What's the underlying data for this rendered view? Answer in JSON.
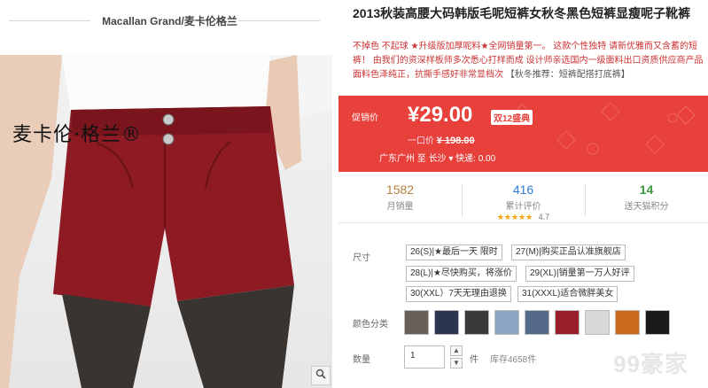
{
  "store": {
    "name": "Macallan Grand/麦卡伦格兰"
  },
  "brand_logo": "麦卡伦·格兰®",
  "product": {
    "title": "2013秋装高腰大码韩版毛呢短裤女秋冬黑色短裤显瘦呢子靴裤",
    "desc_red": "不掉色 不起球 ★升级版加厚呢料★全网销量第一。 这款个性独特 请新优雅而又含蓄的短裤！ 由我们的资深样板师多次悉心打样而成 设计师亲选国内一级面料出口资质供应商产品 面料色泽纯正，抗撕手感好非常显档次",
    "desc_tail": "【秋冬推荐：短裤配搭打底裤】"
  },
  "price": {
    "promo_label": "促销价",
    "current": "¥29.00",
    "badge": "双12盛典",
    "orig_label": "一口价",
    "orig_value": "¥ 198.00",
    "ship_from": "广东广州 至",
    "ship_to": "长沙",
    "ship_fee": "快递: 0.00",
    "accent": "#e8413c"
  },
  "stats": {
    "sold_value": "1582",
    "sold_label": "月销量",
    "review_value": "416",
    "review_label": "累计评价",
    "rating_stars": "★★★★★",
    "rating": "4.7",
    "points_value": "14",
    "points_label": "送天猫积分"
  },
  "options": {
    "size_label": "尺寸",
    "sizes": [
      "26(S)|★最后一天 限时",
      "27(M)|购买正品认准旗舰店",
      "28(L)|★尽快购买，将涨价",
      "29(XL)|销量第一万人好评",
      "30(XXL）7天无理由退换",
      "31(XXXL)适合微胖美女"
    ],
    "color_label": "颜色分类",
    "swatch_colors": [
      "#6a6058",
      "#2b3550",
      "#3a3a3c",
      "#8aa4c4",
      "#556a8a",
      "#9a1f2a",
      "#d8d8d8",
      "#c86a1a",
      "#1a1a1a",
      "#2a2a2a"
    ],
    "qty_label": "数量",
    "qty_value": "1",
    "qty_unit": "件",
    "stock": "库存4658件"
  },
  "watermark": "99豪家"
}
